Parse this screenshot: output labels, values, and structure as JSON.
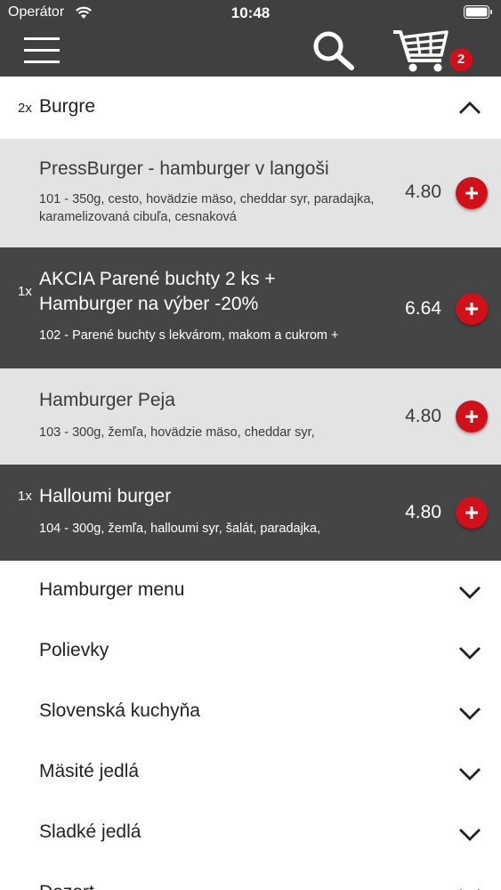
{
  "status": {
    "carrier": "Operátor",
    "time": "10:48"
  },
  "nav": {
    "cart_count": "2"
  },
  "category": {
    "count": "2x",
    "title": "Burgre"
  },
  "products": [
    {
      "qty": "",
      "name": "PressBurger - hamburger v langoši",
      "desc": "101 - 350g, cesto, hovädzie mäso, cheddar syr, paradajka, karamelizovaná cibuľa, cesnaková",
      "price": "4.80"
    },
    {
      "qty": "1x",
      "name": "AKCIA Parené buchty 2 ks + Hamburger na výber -20%",
      "desc": "102 - Parené buchty s lekvárom, makom a cukrom +",
      "price": "6.64"
    },
    {
      "qty": "",
      "name": "Hamburger Peja",
      "desc": "103 - 300g, žemľa, hovädzie mäso, cheddar syr,",
      "price": "4.80"
    },
    {
      "qty": "1x",
      "name": "Halloumi burger",
      "desc": "104 - 300g, žemľa, halloumi syr, šalát, paradajka,",
      "price": "4.80"
    }
  ],
  "categories": [
    {
      "label": "Hamburger menu"
    },
    {
      "label": "Polievky"
    },
    {
      "label": "Slovenská kuchyňa"
    },
    {
      "label": "Mäsité jedlá"
    },
    {
      "label": "Sladké jedlá"
    },
    {
      "label": "Dezert"
    }
  ]
}
